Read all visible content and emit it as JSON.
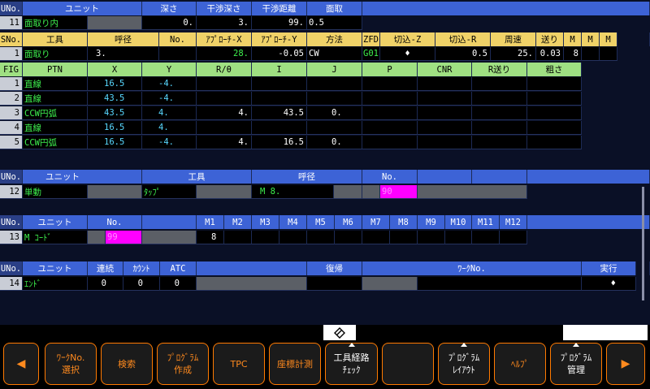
{
  "colors": {
    "header": "#3d63d6",
    "background": "#0a1026",
    "yellow_header": "#f0d268",
    "green_header": "#9fe082",
    "green_text": "#3ef04e",
    "cyan_text": "#58d8ff",
    "magenta": "#ff00ff",
    "orange": "#ff7a00"
  },
  "unit_chamfer": {
    "headers": [
      "UNo.",
      "ユニット",
      "深さ",
      "干渉深さ",
      "干渉距離",
      "面取"
    ],
    "row": {
      "no": "11",
      "unit": "面取り内",
      "depth": "0.",
      "int_depth": "3.",
      "int_dist": "99.",
      "chamfer": "0.5"
    }
  },
  "tool_seq": {
    "headers": [
      "SNo.",
      "工具",
      "呼径",
      "No.",
      "ｱﾌﾟﾛｰﾁ-X",
      "ｱﾌﾟﾛｰﾁ-Y",
      "方法",
      "ZFD",
      "切込-Z",
      "切込-R",
      "周速",
      "送り",
      "M",
      "M",
      "M"
    ],
    "row": {
      "no": "1",
      "tool": "面取り",
      "nominal": "3.",
      "approach_x": "28.",
      "approach_y": "-0.05",
      "method": "CW",
      "zfd": "G01",
      "cut_z": "♦",
      "cut_r": "0.5",
      "speed": "25.",
      "feed": "0.03",
      "m1": "8"
    }
  },
  "figure": {
    "headers": [
      "FIG",
      "PTN",
      "X",
      "Y",
      "R/θ",
      "I",
      "J",
      "P",
      "CNR",
      "R送り",
      "粗さ"
    ],
    "rows": [
      {
        "no": "1",
        "ptn": "直線",
        "x": "16.5",
        "y": "-4.",
        "r": "",
        "i": "",
        "j": ""
      },
      {
        "no": "2",
        "ptn": "直線",
        "x": "43.5",
        "y": "-4.",
        "r": "",
        "i": "",
        "j": ""
      },
      {
        "no": "3",
        "ptn": "CCW円弧",
        "x": "43.5",
        "y": "4.",
        "r": "4.",
        "i": "43.5",
        "j": "0."
      },
      {
        "no": "4",
        "ptn": "直線",
        "x": "16.5",
        "y": "4.",
        "r": "",
        "i": "",
        "j": ""
      },
      {
        "no": "5",
        "ptn": "CCW円弧",
        "x": "16.5",
        "y": "-4.",
        "r": "4.",
        "i": "16.5",
        "j": "0."
      }
    ]
  },
  "unit_manual": {
    "headers": [
      "UNo.",
      "ユニット",
      "工具",
      "呼径",
      "No."
    ],
    "row": {
      "no": "12",
      "unit": "単動",
      "tool": "ﾀｯﾌﾟ",
      "nominal": "M 8.",
      "tool_no": "90"
    }
  },
  "unit_mcode": {
    "headers": [
      "UNo.",
      "ユニット",
      "No.",
      "M1",
      "M2",
      "M3",
      "M4",
      "M5",
      "M6",
      "M7",
      "M8",
      "M9",
      "M10",
      "M11",
      "M12"
    ],
    "row": {
      "no": "13",
      "unit": "M ｺｰﾄﾞ",
      "mno": "99",
      "m1": "8"
    }
  },
  "unit_end": {
    "headers": [
      "UNo.",
      "ユニット",
      "連続",
      "ｶｳﾝﾄ",
      "ATC",
      "復帰",
      "ﾜｰｸNo.",
      "実行"
    ],
    "row": {
      "no": "14",
      "unit": "ｴﾝﾄﾞ",
      "cont": "0",
      "count": "0",
      "atc": "0",
      "exec": "♦"
    }
  },
  "cursor_icon": "pencil-diamond-icon",
  "softkeys": [
    {
      "l1": "◀",
      "l2": ""
    },
    {
      "l1": "ﾜｰｸNo.",
      "l2": "選択"
    },
    {
      "l1": "検索",
      "l2": ""
    },
    {
      "l1": "ﾌﾟﾛｸﾞﾗﾑ",
      "l2": "作成"
    },
    {
      "l1": "TPC",
      "l2": ""
    },
    {
      "l1": "座標計測",
      "l2": ""
    },
    {
      "l1": "工具経路",
      "l2": "ﾁｪｯｸ"
    },
    {
      "l1": "",
      "l2": ""
    },
    {
      "l1": "ﾌﾟﾛｸﾞﾗﾑ",
      "l2": "ﾚｲｱｳﾄ"
    },
    {
      "l1": "ﾍﾙﾌﾟ",
      "l2": ""
    },
    {
      "l1": "ﾌﾟﾛｸﾞﾗﾑ",
      "l2": "管理"
    },
    {
      "l1": "▶",
      "l2": ""
    }
  ]
}
